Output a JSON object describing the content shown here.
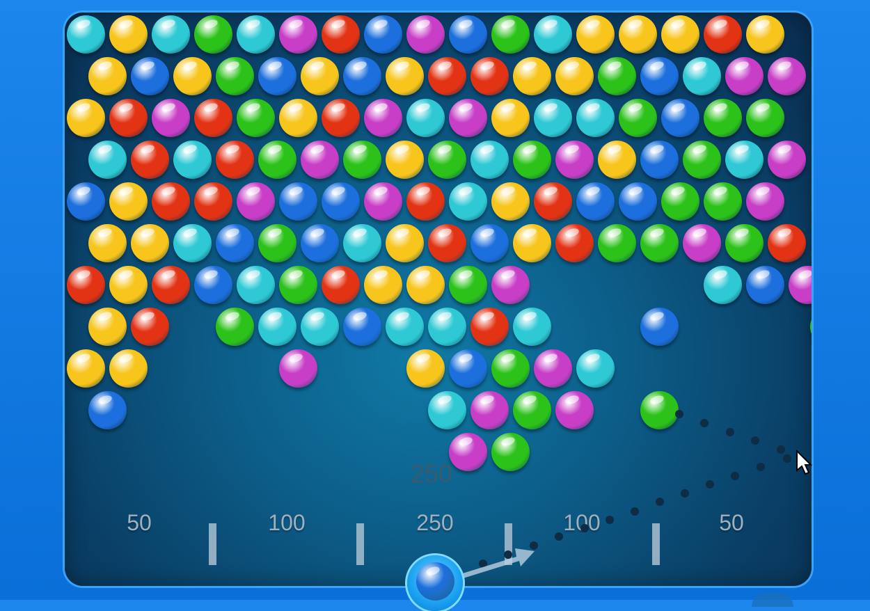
{
  "colors": {
    "yellow": "#f7c51b",
    "cyan": "#2ec9d4",
    "green": "#2cc21a",
    "magenta": "#c83ec6",
    "red": "#e33315",
    "blue": "#1c6fdc",
    "frame_border": "#3aa2f7",
    "aim_dot": "#0e2c44"
  },
  "grid": [
    "CYCGCMRBMBGCYYYRY",
    " YBYGBYBYRRYYGBCMM",
    "YRMRGYRMCMYCCGBGG",
    " CRCRGMGYGCGMYBGCM",
    "BYRRMBBMRCYRBBGGM",
    " YYCBGBCYRBYRGGMGR",
    "RYRBCGRYYGM....CBM",
    " YR.GCCBCCRC..B...G",
    "YY...M..YBGMC",
    " B.......CMGM.G",
    ".........MG"
  ],
  "score_zones": [
    "50",
    "100",
    "250",
    "100",
    "50"
  ],
  "points_popup": "250",
  "shooter": {
    "current_bubble_color": "blue"
  }
}
